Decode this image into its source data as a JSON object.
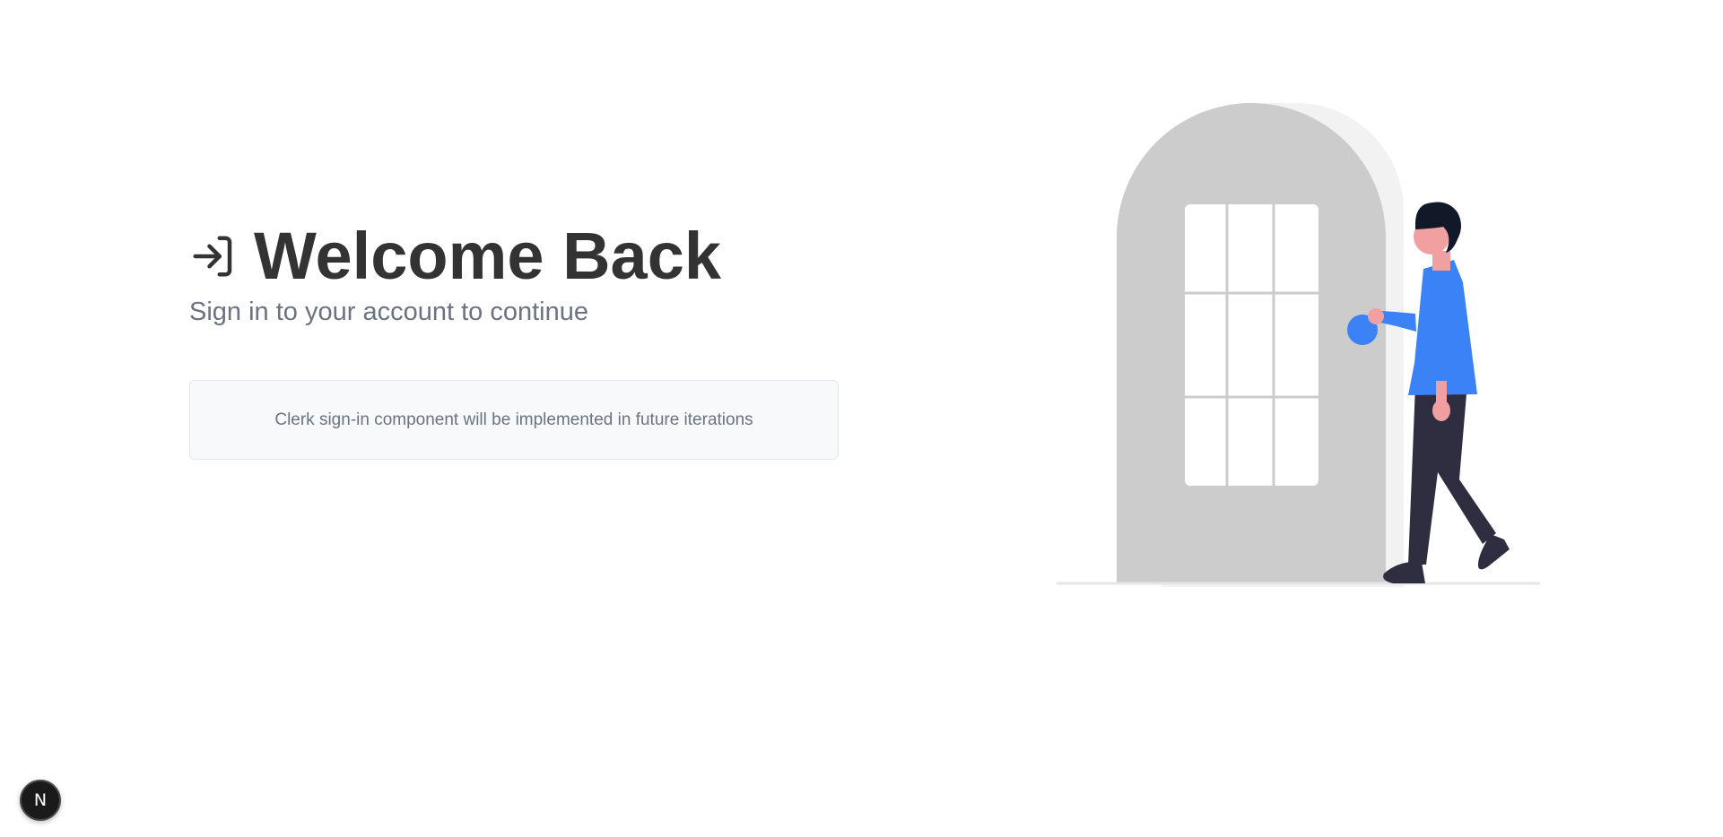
{
  "header": {
    "title": "Welcome Back",
    "subtitle": "Sign in to your account to continue",
    "icon": "sign-in-arrow-icon"
  },
  "signin": {
    "placeholder_text": "Clerk sign-in component will be implemented in future iterations"
  },
  "illustration": {
    "name": "person-entering-door-illustration",
    "colors": {
      "door": "#cccccc",
      "door_shadow": "#f2f2f2",
      "window": "#ffffff",
      "accent": "#3b82f6",
      "skin": "#f0a0a0",
      "hair": "#111827",
      "pants": "#2f2e41"
    }
  },
  "dev_badge": {
    "label": "N",
    "icon": "nextjs-logo-icon"
  },
  "theme": {
    "title_color": "#333333",
    "muted_text": "#6b7280",
    "box_bg": "#f8f9fa"
  }
}
